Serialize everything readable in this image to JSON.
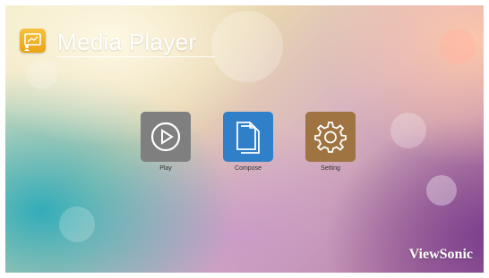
{
  "header": {
    "title": "Media Player"
  },
  "apps": [
    {
      "label": "Play",
      "icon": "play-icon",
      "color": "#7f7f7f"
    },
    {
      "label": "Compose",
      "icon": "document-icon",
      "color": "#2f7fc9"
    },
    {
      "label": "Setting",
      "icon": "gear-icon",
      "color": "#9f7441"
    }
  ],
  "brand": {
    "name": "ViewSonic"
  },
  "colors": {
    "logo_bg": "#f2b52e"
  }
}
